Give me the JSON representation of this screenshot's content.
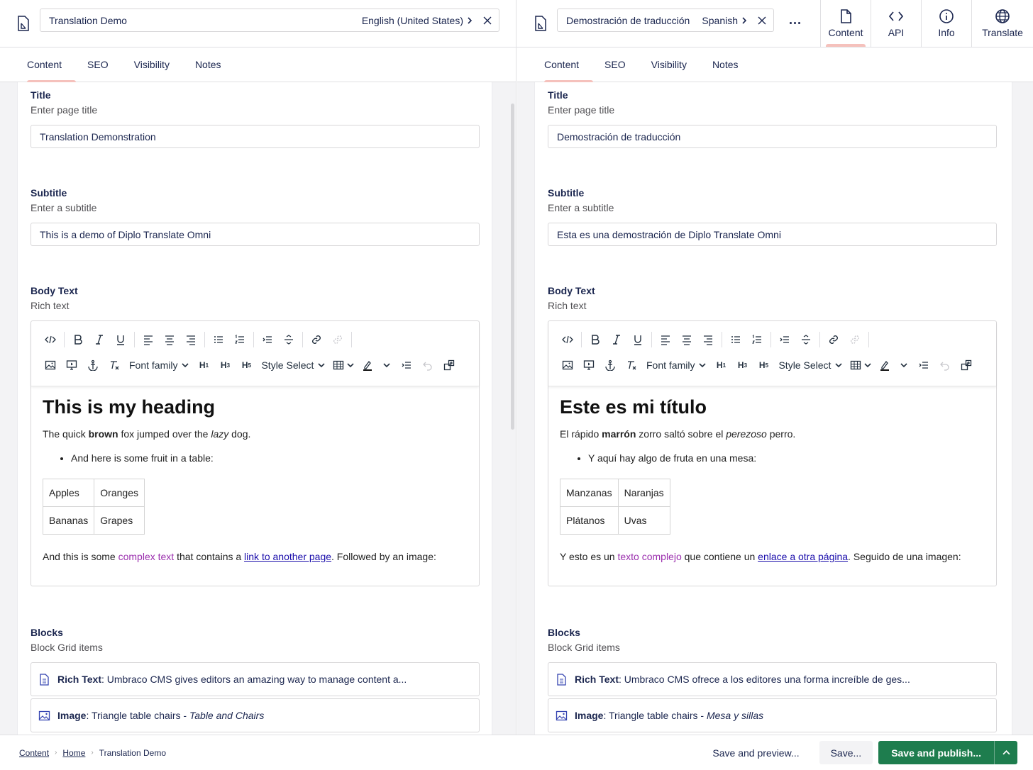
{
  "left": {
    "name": "Translation Demo",
    "language": "English (United States)",
    "tabs": [
      "Content",
      "SEO",
      "Visibility",
      "Notes"
    ],
    "title_label": "Title",
    "title_desc": "Enter page title",
    "title_value": "Translation Demonstration",
    "subtitle_label": "Subtitle",
    "subtitle_desc": "Enter a subtitle",
    "subtitle_value": "This is a demo of Diplo Translate Omni",
    "body_label": "Body Text",
    "body_desc": "Rich text",
    "rte": {
      "heading": "This is my heading",
      "p1_a": "The quick ",
      "p1_bold": "brown",
      "p1_b": " fox jumped over the ",
      "p1_italic": "lazy",
      "p1_c": " dog.",
      "bullet": "And here is some fruit in a table:",
      "table": [
        [
          "Apples",
          "Oranges"
        ],
        [
          "Bananas",
          "Grapes"
        ]
      ],
      "p2_a": "And this is some ",
      "p2_purple": "complex text",
      "p2_b": " that contains a ",
      "p2_link": "link to another page",
      "p2_c": ". Followed by an image:"
    },
    "blocks_label": "Blocks",
    "blocks_desc": "Block Grid items",
    "blocks": [
      {
        "type": "Rich Text",
        "text": ": Umbraco CMS gives editors an amazing way to manage content a...",
        "italic": ""
      },
      {
        "type": "Image",
        "text": ": Triangle table chairs - ",
        "italic": "Table and Chairs"
      }
    ]
  },
  "right": {
    "name": "Demostración de traducción",
    "language": "Spanish",
    "tabs": [
      "Content",
      "SEO",
      "Visibility",
      "Notes"
    ],
    "title_label": "Title",
    "title_desc": "Enter page title",
    "title_value": "Demostración de traducción",
    "subtitle_label": "Subtitle",
    "subtitle_desc": "Enter a subtitle",
    "subtitle_value": "Esta es una demostración de Diplo Translate Omni",
    "body_label": "Body Text",
    "body_desc": "Rich text",
    "rte": {
      "heading": "Este es mi título",
      "p1_a": "El rápido ",
      "p1_bold": "marrón",
      "p1_b": " zorro saltó sobre el ",
      "p1_italic": "perezoso",
      "p1_c": " perro.",
      "bullet": "Y aquí hay algo de fruta en una mesa:",
      "table": [
        [
          "Manzanas",
          "Naranjas"
        ],
        [
          "Plátanos",
          "Uvas"
        ]
      ],
      "p2_a": "Y esto es un ",
      "p2_purple": "texto complejo",
      "p2_b": " que contiene un ",
      "p2_link": "enlace a otra página",
      "p2_c": ". Seguido de una imagen:"
    },
    "blocks_label": "Blocks",
    "blocks_desc": "Block Grid items",
    "blocks": [
      {
        "type": "Rich Text",
        "text": ": Umbraco CMS ofrece a los editores una forma increíble de ges...",
        "italic": ""
      },
      {
        "type": "Image",
        "text": ": Triangle table chairs - ",
        "italic": "Mesa y sillas"
      }
    ]
  },
  "toolbar": {
    "font_family": "Font family",
    "style_select": "Style Select",
    "h1": "H",
    "h3": "H",
    "h5": "H",
    "h1_sub": "1",
    "h3_sub": "3",
    "h5_sub": "5"
  },
  "app_nav": [
    {
      "label": "Content",
      "icon": "document-icon",
      "active": true
    },
    {
      "label": "API",
      "icon": "code-icon",
      "active": false
    },
    {
      "label": "Info",
      "icon": "info-icon",
      "active": false
    },
    {
      "label": "Translate",
      "icon": "globe-icon",
      "active": false
    }
  ],
  "footer": {
    "crumb_1": "Content",
    "crumb_2": "Home",
    "crumb_3": "Translation Demo",
    "save_preview": "Save and preview...",
    "save": "Save...",
    "save_publish": "Save and publish..."
  },
  "colors": {
    "accent_tab": "#f5c1bc",
    "publish_button": "#1e7d4e",
    "complex_text": "#9b2fae",
    "link": "#1a0dab"
  }
}
